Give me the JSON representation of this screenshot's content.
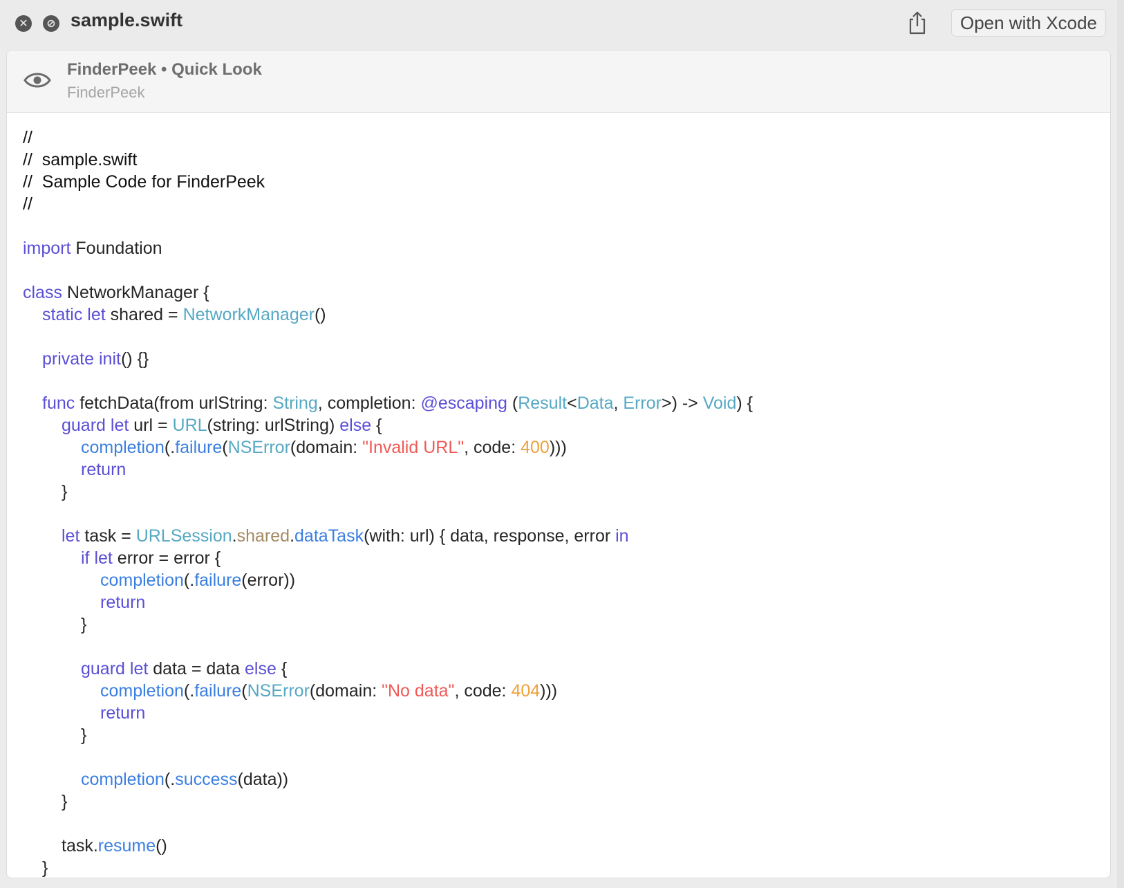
{
  "titlebar": {
    "title": "sample.swift",
    "close_icon": "close-icon",
    "noentry_icon": "no-entry-icon",
    "share_icon": "share-icon",
    "open_button_label": "Open with Xcode"
  },
  "banner": {
    "icon": "eye-icon",
    "title": "FinderPeek • Quick Look",
    "subtitle": "FinderPeek"
  },
  "colors": {
    "keyword": "#5b4fd6",
    "type": "#56a8c3",
    "function": "#3b7fe0",
    "property": "#a38a63",
    "string": "#ef5a56",
    "number": "#f0a13a",
    "plain": "#262626"
  },
  "code_lines": [
    {
      "indent": 0,
      "tokens": [
        {
          "t": "//",
          "c": "comment"
        }
      ]
    },
    {
      "indent": 0,
      "tokens": [
        {
          "t": "//  sample.swift",
          "c": "comment"
        }
      ]
    },
    {
      "indent": 0,
      "tokens": [
        {
          "t": "//  Sample Code for FinderPeek",
          "c": "comment"
        }
      ]
    },
    {
      "indent": 0,
      "tokens": [
        {
          "t": "//",
          "c": "comment"
        }
      ]
    },
    {
      "indent": 0,
      "tokens": []
    },
    {
      "indent": 0,
      "tokens": [
        {
          "t": "import",
          "c": "kw"
        },
        {
          "t": " Foundation",
          "c": "plain"
        }
      ]
    },
    {
      "indent": 0,
      "tokens": []
    },
    {
      "indent": 0,
      "tokens": [
        {
          "t": "class",
          "c": "kw"
        },
        {
          "t": " NetworkManager {",
          "c": "plain"
        }
      ]
    },
    {
      "indent": 1,
      "tokens": [
        {
          "t": "static let",
          "c": "kw"
        },
        {
          "t": " shared = ",
          "c": "plain"
        },
        {
          "t": "NetworkManager",
          "c": "type"
        },
        {
          "t": "()",
          "c": "plain"
        }
      ]
    },
    {
      "indent": 0,
      "tokens": []
    },
    {
      "indent": 1,
      "tokens": [
        {
          "t": "private init",
          "c": "kw"
        },
        {
          "t": "() {}",
          "c": "plain"
        }
      ]
    },
    {
      "indent": 0,
      "tokens": []
    },
    {
      "indent": 1,
      "tokens": [
        {
          "t": "func",
          "c": "kw"
        },
        {
          "t": " fetchData(from urlString: ",
          "c": "plain"
        },
        {
          "t": "String",
          "c": "type"
        },
        {
          "t": ", completion: ",
          "c": "plain"
        },
        {
          "t": "@escaping",
          "c": "kw"
        },
        {
          "t": " (",
          "c": "plain"
        },
        {
          "t": "Result",
          "c": "type"
        },
        {
          "t": "<",
          "c": "plain"
        },
        {
          "t": "Data",
          "c": "type"
        },
        {
          "t": ", ",
          "c": "plain"
        },
        {
          "t": "Error",
          "c": "type"
        },
        {
          "t": ">) -> ",
          "c": "plain"
        },
        {
          "t": "Void",
          "c": "type"
        },
        {
          "t": ") {",
          "c": "plain"
        }
      ]
    },
    {
      "indent": 2,
      "tokens": [
        {
          "t": "guard let",
          "c": "kw"
        },
        {
          "t": " url = ",
          "c": "plain"
        },
        {
          "t": "URL",
          "c": "type"
        },
        {
          "t": "(string: urlString) ",
          "c": "plain"
        },
        {
          "t": "else",
          "c": "kw"
        },
        {
          "t": " {",
          "c": "plain"
        }
      ]
    },
    {
      "indent": 3,
      "tokens": [
        {
          "t": "completion",
          "c": "fn"
        },
        {
          "t": "(.",
          "c": "plain"
        },
        {
          "t": "failure",
          "c": "fn"
        },
        {
          "t": "(",
          "c": "plain"
        },
        {
          "t": "NSError",
          "c": "type"
        },
        {
          "t": "(domain: ",
          "c": "plain"
        },
        {
          "t": "\"Invalid URL\"",
          "c": "str"
        },
        {
          "t": ", code: ",
          "c": "plain"
        },
        {
          "t": "400",
          "c": "num"
        },
        {
          "t": ")))",
          "c": "plain"
        }
      ]
    },
    {
      "indent": 3,
      "tokens": [
        {
          "t": "return",
          "c": "kw"
        }
      ]
    },
    {
      "indent": 2,
      "tokens": [
        {
          "t": "}",
          "c": "plain"
        }
      ]
    },
    {
      "indent": 0,
      "tokens": []
    },
    {
      "indent": 2,
      "tokens": [
        {
          "t": "let",
          "c": "kw"
        },
        {
          "t": " task = ",
          "c": "plain"
        },
        {
          "t": "URLSession",
          "c": "type"
        },
        {
          "t": ".",
          "c": "plain"
        },
        {
          "t": "shared",
          "c": "prop"
        },
        {
          "t": ".",
          "c": "plain"
        },
        {
          "t": "dataTask",
          "c": "fn"
        },
        {
          "t": "(with: url) { data, response, error ",
          "c": "plain"
        },
        {
          "t": "in",
          "c": "kw"
        }
      ]
    },
    {
      "indent": 3,
      "tokens": [
        {
          "t": "if let",
          "c": "kw"
        },
        {
          "t": " error = error {",
          "c": "plain"
        }
      ]
    },
    {
      "indent": 4,
      "tokens": [
        {
          "t": "completion",
          "c": "fn"
        },
        {
          "t": "(.",
          "c": "plain"
        },
        {
          "t": "failure",
          "c": "fn"
        },
        {
          "t": "(error))",
          "c": "plain"
        }
      ]
    },
    {
      "indent": 4,
      "tokens": [
        {
          "t": "return",
          "c": "kw"
        }
      ]
    },
    {
      "indent": 3,
      "tokens": [
        {
          "t": "}",
          "c": "plain"
        }
      ]
    },
    {
      "indent": 0,
      "tokens": []
    },
    {
      "indent": 3,
      "tokens": [
        {
          "t": "guard let",
          "c": "kw"
        },
        {
          "t": " data = data ",
          "c": "plain"
        },
        {
          "t": "else",
          "c": "kw"
        },
        {
          "t": " {",
          "c": "plain"
        }
      ]
    },
    {
      "indent": 4,
      "tokens": [
        {
          "t": "completion",
          "c": "fn"
        },
        {
          "t": "(.",
          "c": "plain"
        },
        {
          "t": "failure",
          "c": "fn"
        },
        {
          "t": "(",
          "c": "plain"
        },
        {
          "t": "NSError",
          "c": "type"
        },
        {
          "t": "(domain: ",
          "c": "plain"
        },
        {
          "t": "\"No data\"",
          "c": "str"
        },
        {
          "t": ", code: ",
          "c": "plain"
        },
        {
          "t": "404",
          "c": "num"
        },
        {
          "t": ")))",
          "c": "plain"
        }
      ]
    },
    {
      "indent": 4,
      "tokens": [
        {
          "t": "return",
          "c": "kw"
        }
      ]
    },
    {
      "indent": 3,
      "tokens": [
        {
          "t": "}",
          "c": "plain"
        }
      ]
    },
    {
      "indent": 0,
      "tokens": []
    },
    {
      "indent": 3,
      "tokens": [
        {
          "t": "completion",
          "c": "fn"
        },
        {
          "t": "(.",
          "c": "plain"
        },
        {
          "t": "success",
          "c": "fn"
        },
        {
          "t": "(data))",
          "c": "plain"
        }
      ]
    },
    {
      "indent": 2,
      "tokens": [
        {
          "t": "}",
          "c": "plain"
        }
      ]
    },
    {
      "indent": 0,
      "tokens": []
    },
    {
      "indent": 2,
      "tokens": [
        {
          "t": "task.",
          "c": "plain"
        },
        {
          "t": "resume",
          "c": "fn"
        },
        {
          "t": "()",
          "c": "plain"
        }
      ]
    },
    {
      "indent": 1,
      "tokens": [
        {
          "t": "}",
          "c": "plain"
        }
      ]
    }
  ]
}
